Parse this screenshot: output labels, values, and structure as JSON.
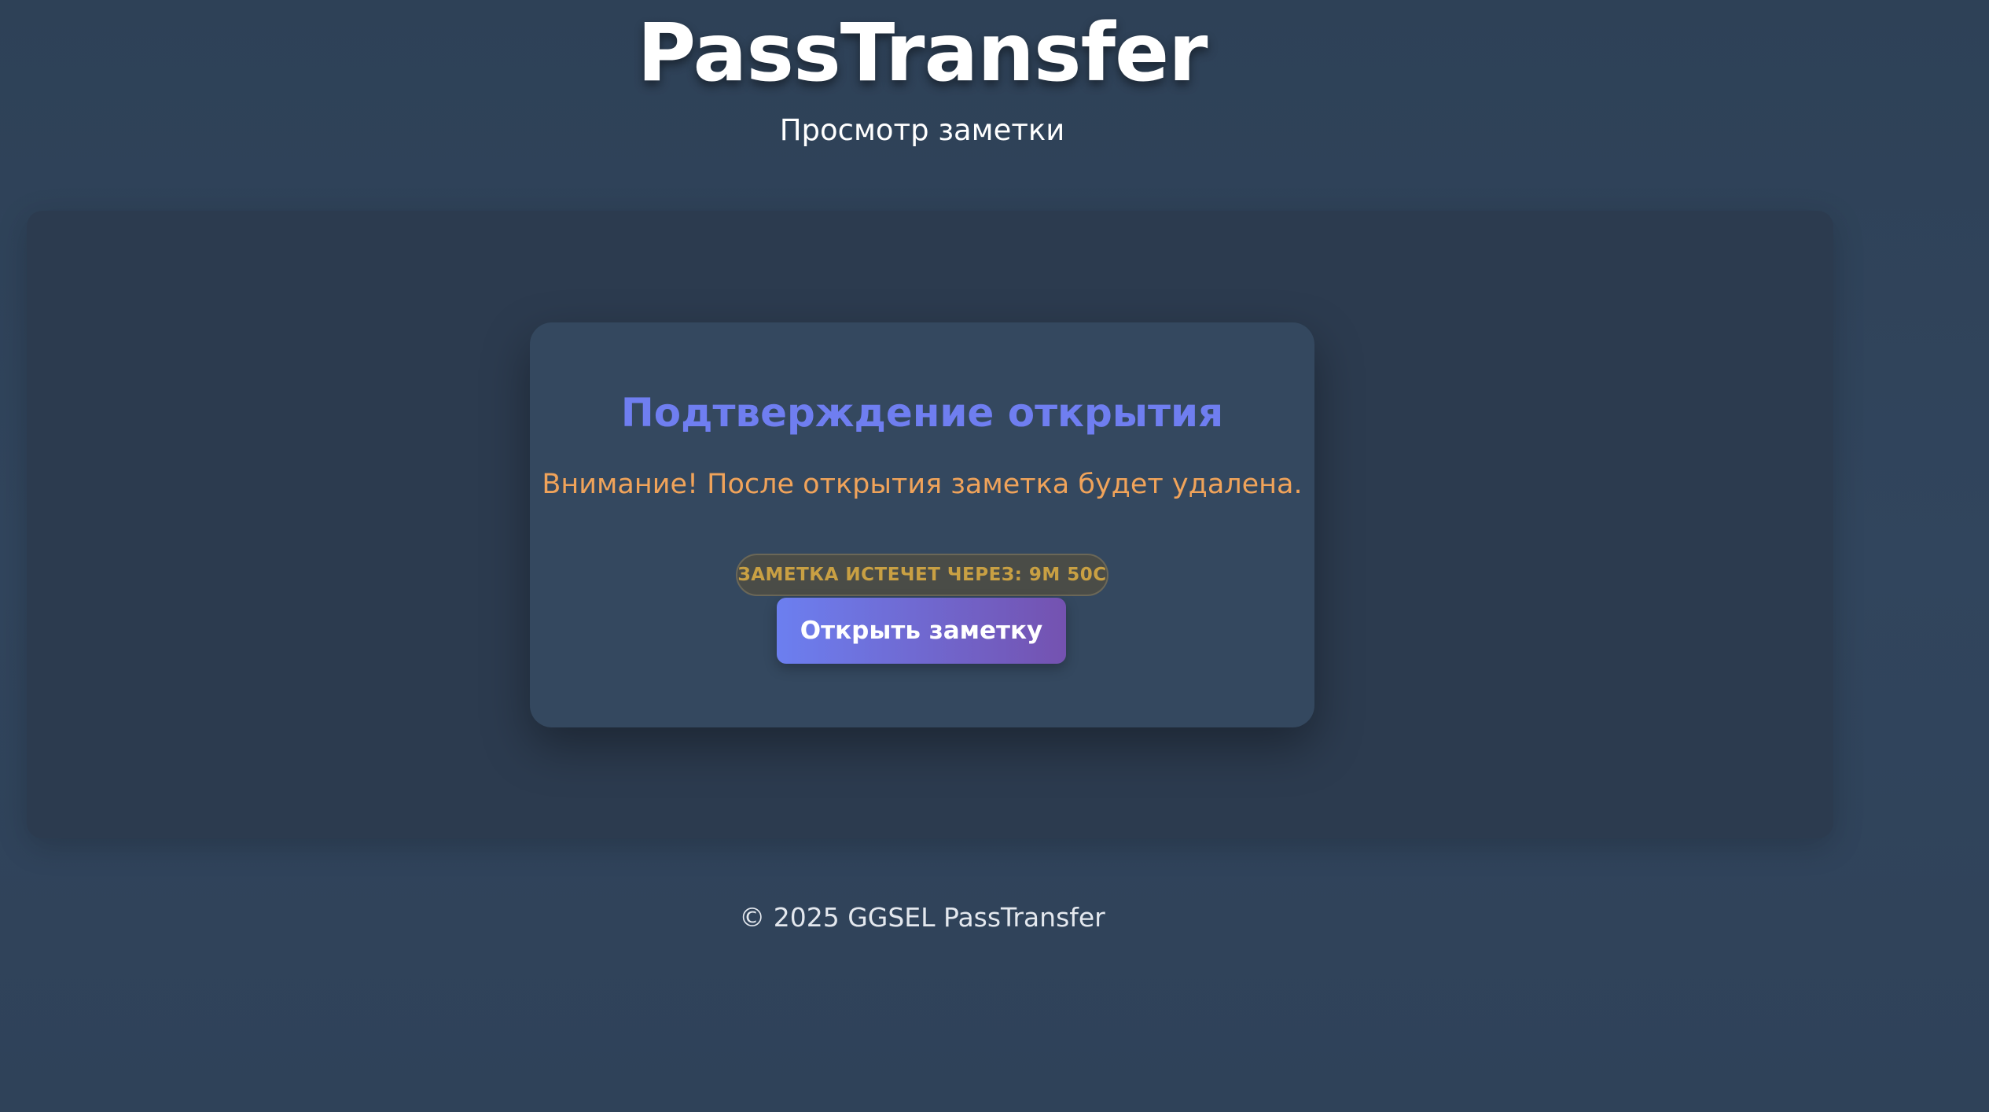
{
  "header": {
    "title": "PassTransfer",
    "subtitle": "Просмотр заметки"
  },
  "confirm": {
    "title": "Подтверждение открытия",
    "warning": "Внимание! После открытия заметка будет удалена.",
    "expiry_badge": "ЗАМЕТКА ИСТЕЧЕТ ЧЕРЕЗ: 9М 50С",
    "open_button_label": "Открыть заметку"
  },
  "footer": {
    "copyright": "© 2025 GGSEL PassTransfer"
  },
  "colors": {
    "background": "#2f4259",
    "panel": "#2c3b4f",
    "card": "#34485f",
    "title_accent": "#6f7ef0",
    "warning": "#f0a35a",
    "badge_text": "#c9a043",
    "button_gradient_start": "#6c7ff0",
    "button_gradient_end": "#7452b0"
  }
}
